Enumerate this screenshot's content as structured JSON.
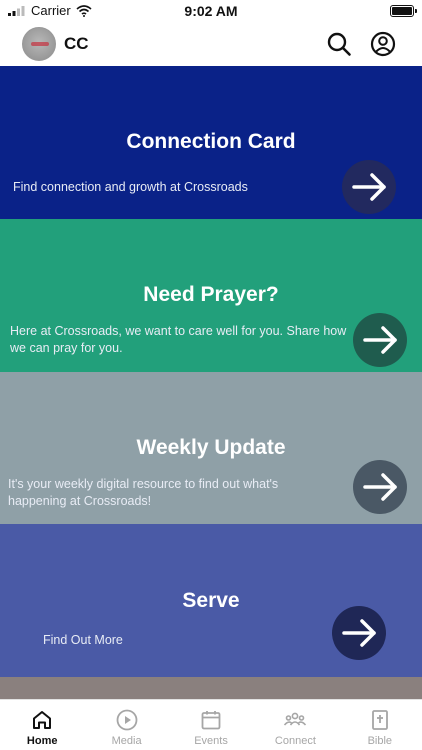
{
  "status_bar": {
    "carrier": "Carrier",
    "time": "9:02 AM"
  },
  "app_bar": {
    "title": "CC",
    "icons": [
      "search-icon",
      "profile-icon"
    ]
  },
  "cards": [
    {
      "title": "Connection Card",
      "subtitle": "Find connection and growth at Crossroads",
      "color": "#0a2288",
      "arrow_bg": "#22295f",
      "icon": "arrow-right-icon"
    },
    {
      "title": "Need Prayer?",
      "subtitle": "Here at Crossroads, we want to care well for you.  Share how we can pray for you.",
      "color": "#22a07b",
      "arrow_bg": "#1f5c4e",
      "icon": "arrow-right-icon"
    },
    {
      "title": "Weekly Update",
      "subtitle": "It's your weekly digital resource to find out what's happening at Crossroads!",
      "color": "#8fa0a7",
      "arrow_bg": "#4a5865",
      "icon": "arrow-right-icon"
    },
    {
      "title": "Serve",
      "subtitle": "Find Out More",
      "color": "#4a5aa6",
      "arrow_bg": "#1f2756",
      "icon": "arrow-right-icon"
    }
  ],
  "tab_bar": {
    "active": "Home",
    "tabs": [
      {
        "label": "Home",
        "icon": "home-icon"
      },
      {
        "label": "Media",
        "icon": "play-circle-icon"
      },
      {
        "label": "Events",
        "icon": "calendar-icon"
      },
      {
        "label": "Connect",
        "icon": "group-icon"
      },
      {
        "label": "Bible",
        "icon": "bible-icon"
      }
    ]
  }
}
